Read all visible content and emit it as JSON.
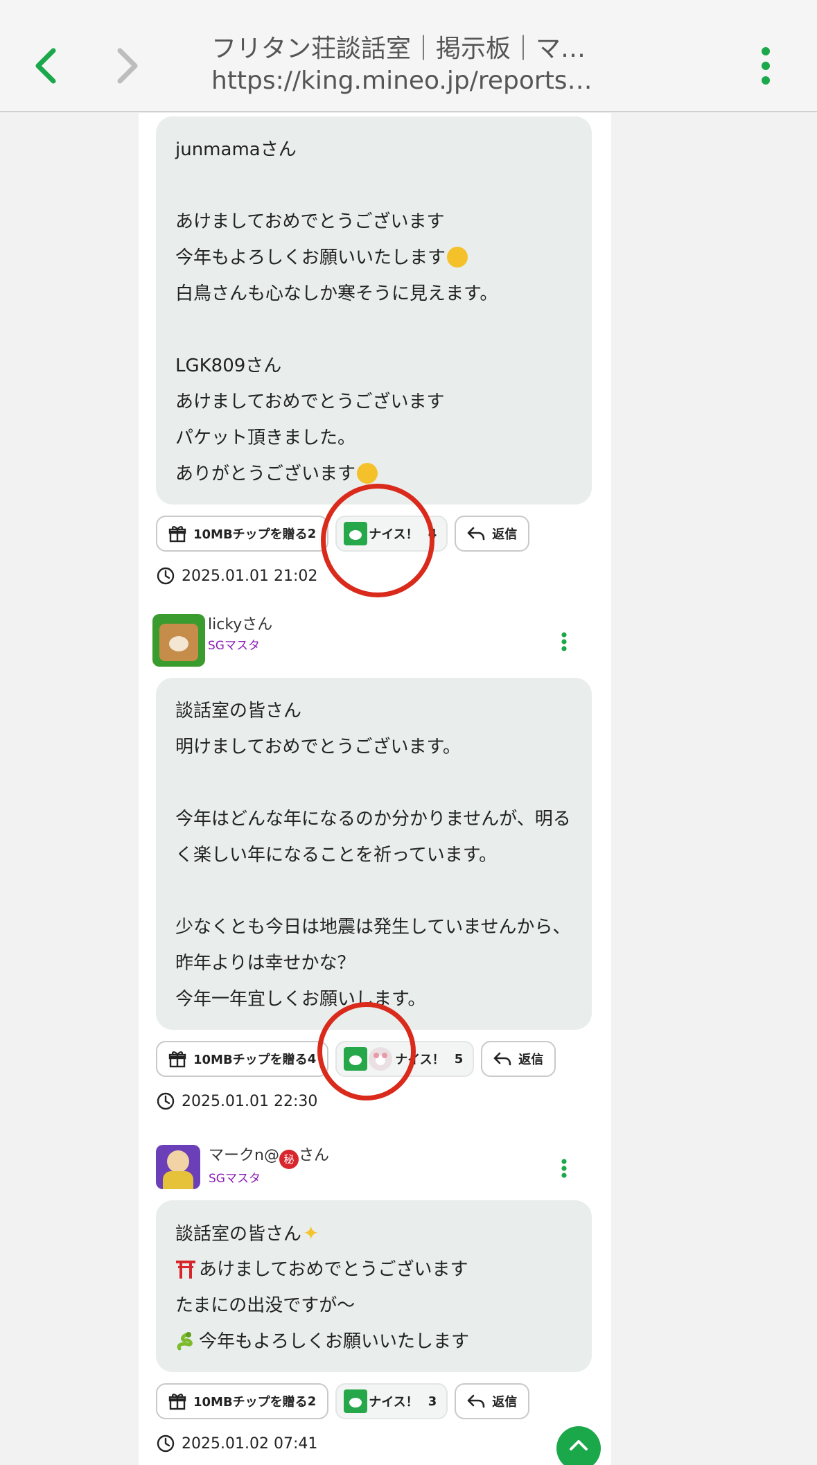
{
  "browser": {
    "title": "フリタン荘談話室｜掲示板｜マ…",
    "url": "https://king.mineo.jp/reports…"
  },
  "posts": [
    {
      "lines": [
        "junmamaさん",
        "",
        "あけましておめでとうございます",
        "今年もよろしくお願いいたします",
        "白鳥さんも心なしか寒そうに見えます。",
        "",
        "LGK809さん",
        "あけましておめでとうございます",
        "パケット頂きました。",
        "ありがとうございます"
      ],
      "tip_label": "10MBチップを贈る",
      "tip_count": "2",
      "nice_label": "ナイス！",
      "nice_count": "4",
      "reply_label": "返信",
      "timestamp": "2025.01.01 21:02"
    },
    {
      "user": "lickyさん",
      "rank": "SGマスタ",
      "lines": [
        "談話室の皆さん",
        "明けましておめでとうございます。",
        "",
        "今年はどんな年になるのか分かりませんが、明る",
        "く楽しい年になることを祈っています。",
        "",
        "少なくとも今日は地震は発生していませんから、",
        "昨年よりは幸せかな？",
        "今年一年宜しくお願いします。"
      ],
      "tip_label": "10MBチップを贈る",
      "tip_count": "4",
      "nice_label": "ナイス！",
      "nice_count": "5",
      "reply_label": "返信",
      "timestamp": "2025.01.01 22:30"
    },
    {
      "user_prefix": "マークn@",
      "user_badge": "秘",
      "user_suffix": "さん",
      "rank": "SGマスタ",
      "lines": [
        "談話室の皆さん",
        "あけましておめでとうございます",
        "たまにの出没ですが〜",
        "今年もよろしくお願いいたします"
      ],
      "tip_label": "10MBチップを贈る",
      "tip_count": "2",
      "nice_label": "ナイス！",
      "nice_count": "3",
      "reply_label": "返信",
      "timestamp": "2025.01.02 07:41"
    }
  ],
  "icons": [
    "chevron-left-icon",
    "chevron-right-icon",
    "more-vertical-icon",
    "gift-icon",
    "reply-icon",
    "clock-icon",
    "chevron-up-icon"
  ],
  "colors": {
    "accent": "#1aa84a",
    "annotation": "#d92a1c",
    "rank": "#8a1fb5",
    "bubble": "#e9eeec"
  }
}
